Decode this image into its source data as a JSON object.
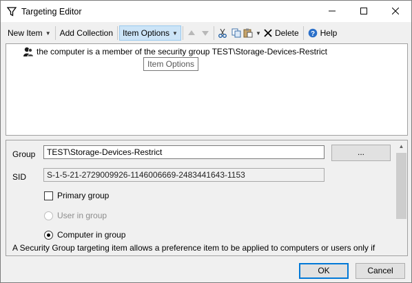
{
  "window": {
    "title": "Targeting Editor"
  },
  "toolbar": {
    "new_item": "New Item",
    "add_collection": "Add Collection",
    "item_options": "Item Options",
    "delete": "Delete",
    "help": "Help"
  },
  "tree": {
    "items": [
      {
        "label": "the computer is a member of the security group TEST\\Storage-Devices-Restrict"
      }
    ],
    "tooltip": "Item Options"
  },
  "props": {
    "group_label": "Group",
    "group_value": "TEST\\Storage-Devices-Restrict",
    "browse_label": "...",
    "sid_label": "SID",
    "sid_value": "S-1-5-21-2729009926-1146006669-2483441643-1153",
    "primary_group": "Primary group",
    "user_in_group": "User in group",
    "computer_in_group": "Computer in group",
    "description": "A Security Group targeting item allows a preference item to be applied to computers or users only if"
  },
  "buttons": {
    "ok": "OK",
    "cancel": "Cancel"
  },
  "colors": {
    "accent": "#0078d7",
    "selection": "#cce4f7"
  }
}
